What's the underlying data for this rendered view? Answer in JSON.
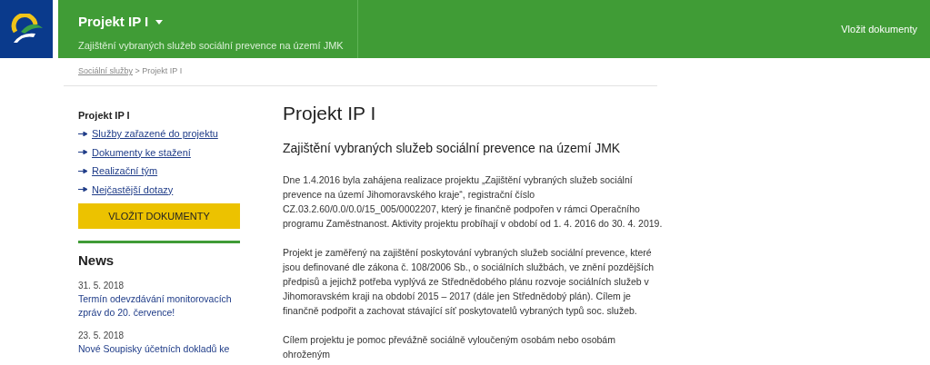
{
  "header": {
    "project_title": "Projekt IP I",
    "project_subtitle": "Zajištění vybraných služeb sociální prevence na území JMK",
    "action_link": "Vložit dokumenty"
  },
  "breadcrumb": {
    "link": "Sociální služby",
    "separator": ">",
    "current": "Projekt IP I"
  },
  "sidebar": {
    "heading": "Projekt IP I",
    "items": [
      {
        "label": "Služby zařazené do projektu"
      },
      {
        "label": "Dokumenty ke stažení"
      },
      {
        "label": "Realizační tým"
      },
      {
        "label": "Nejčastější dotazy"
      }
    ],
    "button": "VLOŽIT DOKUMENTY",
    "news_heading": "News",
    "news": [
      {
        "date": "31. 5. 2018",
        "title": "Termín odevzdávání monitorovacích zpráv do 20. července!"
      },
      {
        "date": "23. 5. 2018",
        "title": "Nové Soupisky účetních dokladů ke"
      }
    ]
  },
  "main": {
    "title": "Projekt IP I",
    "subtitle": "Zajištění vybraných služeb sociální prevence na území JMK",
    "paragraphs": [
      "Dne 1.4.2016 byla zahájena realizace projektu „Zajištění vybraných služeb sociální prevence na území Jihomoravského kraje“, registrační číslo CZ.03.2.60/0.0/0.0/15_005/0002207, který je finančně podpořen v rámci Operačního programu Zaměstnanost. Aktivity projektu probíhají v období od 1. 4. 2016 do 30. 4. 2019.",
      "Projekt je zaměřený na zajištění poskytování vybraných služeb sociální prevence, které jsou definované dle zákona č. 108/2006 Sb., o sociálních službách, ve znění pozdějších předpisů a jejichž potřeba vyplývá ze Střednědobého plánu rozvoje sociálních služeb v Jihomoravském kraji na období 2015 – 2017 (dále jen Střednědobý plán). Cílem je finančně podpořit a zachovat stávající síť poskytovatelů vybraných typů soc. služeb.",
      "Cílem projektu je pomoc převážně sociálně vyloučeným osobám nebo osobám ohroženým"
    ]
  }
}
